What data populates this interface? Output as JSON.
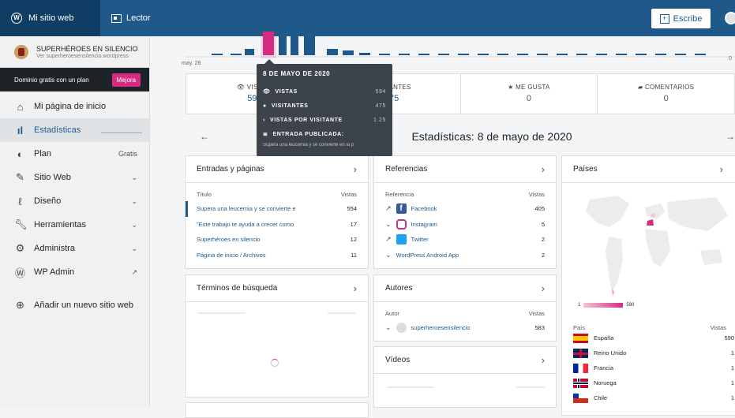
{
  "topbar": {
    "my_site": "Mi sitio web",
    "reader": "Lector",
    "write": "Escribe"
  },
  "sidebar": {
    "site_name": "SUPERHÉROES EN SILENCIO",
    "site_url": "Ver superheroesensilencio.wordpress",
    "promo_text": "Dominio gratis con un plan",
    "promo_button": "Mejora",
    "items": [
      {
        "label": "Mi página de inicio",
        "icon": "home-icon"
      },
      {
        "label": "Estadísticas",
        "icon": "stats-icon"
      },
      {
        "label": "Plan",
        "icon": "plan-icon",
        "right": "Gratis"
      },
      {
        "label": "Sitio Web",
        "icon": "pencil-icon"
      },
      {
        "label": "Diseño",
        "icon": "brush-icon"
      },
      {
        "label": "Herramientas",
        "icon": "wrench-icon"
      },
      {
        "label": "Administra",
        "icon": "gear-icon"
      },
      {
        "label": "WP Admin",
        "icon": "wordpress-icon"
      },
      {
        "label": "Añadir un nuevo sitio web",
        "icon": "add-icon"
      }
    ]
  },
  "chart": {
    "date_label": "may. 28",
    "zero_label": "0"
  },
  "summary": [
    {
      "label": "VISITAS",
      "value": "594"
    },
    {
      "label": "VISITANTES",
      "value": "475"
    },
    {
      "label": "ME GUSTA",
      "value": "0"
    },
    {
      "label": "COMENTARIOS",
      "value": "0"
    }
  ],
  "tooltip": {
    "date": "8 DE MAYO DE 2020",
    "rows": [
      {
        "label": "VISTAS",
        "value": "594"
      },
      {
        "label": "VISITANTES",
        "value": "475"
      },
      {
        "label": "VISTAS POR VISITANTE",
        "value": "1.25"
      },
      {
        "label": "ENTRADA PUBLICADA:",
        "value": ""
      }
    ],
    "post": "Supera una leucemia y se convierte en la p"
  },
  "date_title": "Estadísticas: 8 de mayo de 2020",
  "entries": {
    "title": "Entradas y páginas",
    "col1": "Título",
    "col2": "Vistas",
    "rows": [
      {
        "label": "Supera una leucemia y se convierte e",
        "value": "554"
      },
      {
        "label": "\"Este trabajo te ayuda a crecer como",
        "value": "17"
      },
      {
        "label": "Superhéroes en silencio",
        "value": "12"
      },
      {
        "label": "Página de inicio / Archivos",
        "value": "11"
      }
    ]
  },
  "referrers": {
    "title": "Referencias",
    "col1": "Referencia",
    "col2": "Vistas",
    "rows": [
      {
        "label": "Facebook",
        "value": "405"
      },
      {
        "label": "Instagram",
        "value": "5"
      },
      {
        "label": "Twitter",
        "value": "2"
      },
      {
        "label": "WordPress Android App",
        "value": "2"
      }
    ]
  },
  "countries": {
    "title": "Países",
    "legend_min": "1",
    "legend_max": "590",
    "col1": "País",
    "col2": "Vistas",
    "rows": [
      {
        "label": "España",
        "value": "590"
      },
      {
        "label": "Reino Unido",
        "value": "1"
      },
      {
        "label": "Francia",
        "value": "1"
      },
      {
        "label": "Noruega",
        "value": "1"
      },
      {
        "label": "Chile",
        "value": "1"
      }
    ]
  },
  "search_terms": {
    "title": "Términos de búsqueda"
  },
  "authors": {
    "title": "Autores",
    "col1": "Autor",
    "col2": "Vistas",
    "name": "superheroesensilencio",
    "value": "583"
  },
  "videos": {
    "title": "Vídeos"
  },
  "colors": {
    "accent": "#1e598a",
    "highlight": "#d52c82",
    "topbar": "#1e598a"
  }
}
